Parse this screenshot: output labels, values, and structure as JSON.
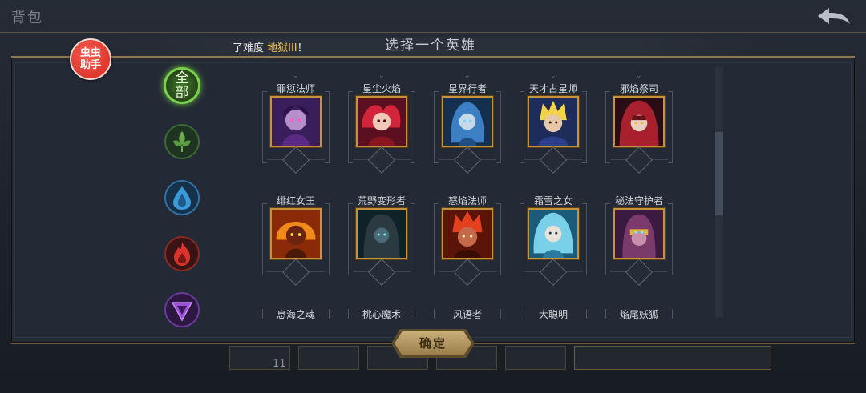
{
  "background": {
    "title": "背包",
    "slot_count": "11"
  },
  "modal": {
    "difficulty_prefix": "了难度 ",
    "difficulty_value": "地狱III",
    "difficulty_suffix": "！",
    "title": "选择一个英雄",
    "confirm_label": "确定"
  },
  "badge": {
    "line1": "虫虫",
    "line2": "助手"
  },
  "filters": [
    {
      "label": "全部",
      "icon": "all-icon",
      "selected": true
    },
    {
      "label": "",
      "icon": "leaf-icon",
      "selected": false
    },
    {
      "label": "",
      "icon": "water-drop-icon",
      "selected": false
    },
    {
      "label": "",
      "icon": "flame-icon",
      "selected": false
    },
    {
      "label": "",
      "icon": "triangle-rune-icon",
      "selected": false
    }
  ],
  "heroes_row1": [
    {
      "name": "罪愆法师"
    },
    {
      "name": "星尘火焰"
    },
    {
      "name": "星界行者"
    },
    {
      "name": "天才占星师"
    },
    {
      "name": "邪焰祭司"
    }
  ],
  "heroes_row2": [
    {
      "name": "绯红女王"
    },
    {
      "name": "荒野变形者"
    },
    {
      "name": "怒焰法师"
    },
    {
      "name": "霜雪之女"
    },
    {
      "name": "秘法守护者"
    }
  ],
  "heroes_row3": [
    {
      "name": "息海之魂"
    },
    {
      "name": "桃心魔术"
    },
    {
      "name": "风语者"
    },
    {
      "name": "大聪明"
    },
    {
      "name": "焰尾妖狐"
    }
  ],
  "colors": {
    "accent_gold": "#c6923a",
    "difficulty_highlight": "#f2c14e",
    "filter_selected": "#7bd14a"
  }
}
